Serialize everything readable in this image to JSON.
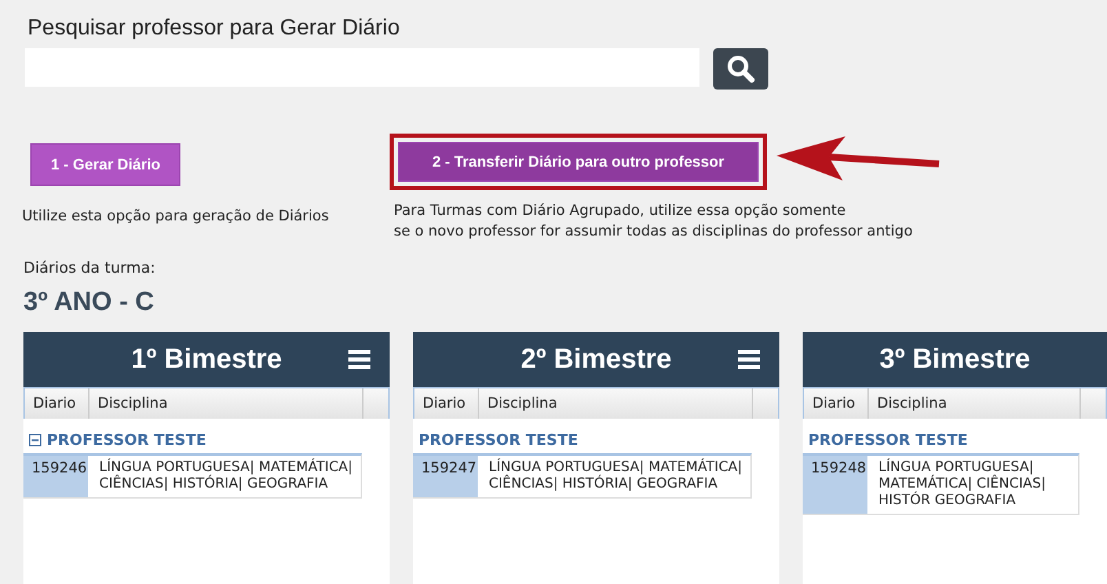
{
  "search": {
    "title": "Pesquisar professor para Gerar Diário"
  },
  "actions": [
    {
      "label": "1 - Gerar Diário",
      "highlighted": false,
      "description": [
        "Utilize esta opção para geração de Diários"
      ]
    },
    {
      "label": "2 - Transferir Diário para outro professor",
      "highlighted": true,
      "description": [
        "Para Turmas com Diário Agrupado, utilize essa opção somente",
        "se o novo professor for assumir todas as disciplinas do professor antigo"
      ]
    }
  ],
  "annotation_arrow": true,
  "section_label": "Diários da turma:",
  "class_name": "3º ANO - C",
  "panels": [
    {
      "title": "1º Bimestre",
      "menu": true,
      "columns": [
        "Diario",
        "Disciplina"
      ],
      "groups": [
        {
          "name": "PROFESSOR TESTE",
          "collapse_toggle": true,
          "rows": [
            {
              "diario": "159246",
              "disciplina": "LÍNGUA PORTUGUESA| MATEMÁTICA| CIÊNCIAS| HISTÓRIA| GEOGRAFIA"
            }
          ]
        }
      ]
    },
    {
      "title": "2º Bimestre",
      "menu": true,
      "columns": [
        "Diario",
        "Disciplina"
      ],
      "groups": [
        {
          "name": "PROFESSOR TESTE",
          "collapse_toggle": false,
          "rows": [
            {
              "diario": "159247",
              "disciplina": "LÍNGUA PORTUGUESA| MATEMÁTICA| CIÊNCIAS| HISTÓRIA| GEOGRAFIA"
            }
          ]
        }
      ]
    },
    {
      "title": "3º Bimestre",
      "menu": false,
      "columns": [
        "Diario",
        "Disciplina"
      ],
      "groups": [
        {
          "name": "PROFESSOR TESTE",
          "collapse_toggle": false,
          "rows": [
            {
              "diario": "159248",
              "disciplina": "LÍNGUA PORTUGUESA| MATEMÁTICA| CIÊNCIAS| HISTÓR GEOGRAFIA"
            }
          ]
        }
      ]
    }
  ]
}
